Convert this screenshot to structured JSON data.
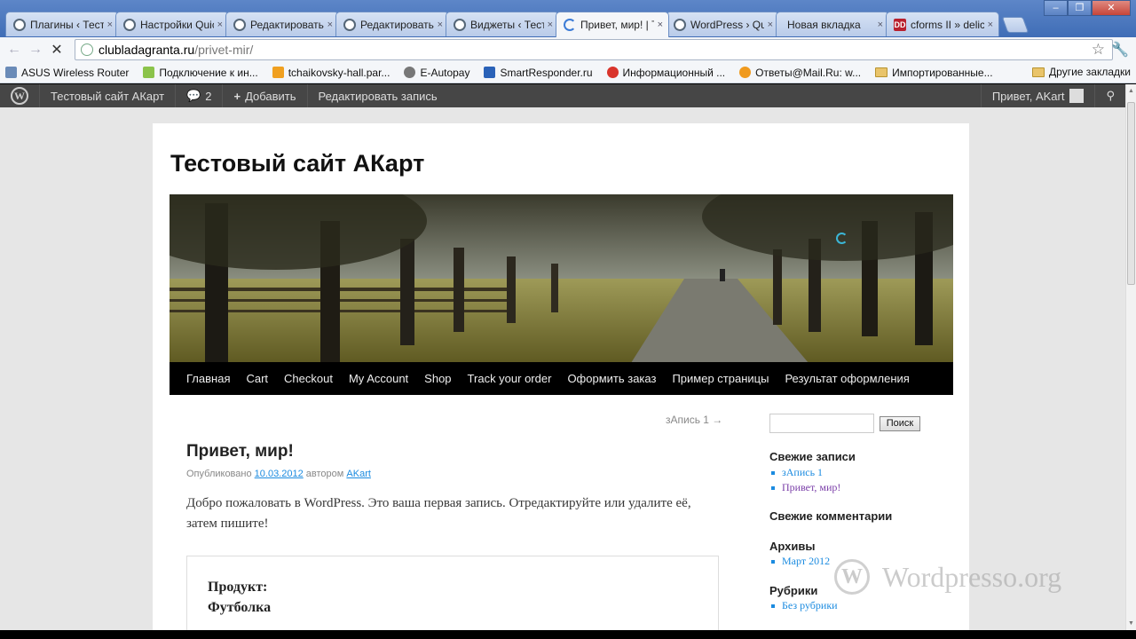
{
  "browser": {
    "tabs": [
      {
        "title": "Плагины ‹ Тест",
        "icon": "wordpress-icon"
      },
      {
        "title": "Настройки Quic",
        "icon": "wordpress-icon"
      },
      {
        "title": "Редактировать",
        "icon": "wordpress-icon"
      },
      {
        "title": "Редактировать",
        "icon": "wordpress-icon"
      },
      {
        "title": "Виджеты ‹ Тест",
        "icon": "wordpress-icon"
      },
      {
        "title": "Привет, мир! | Т",
        "icon": "loading-icon",
        "active": true
      },
      {
        "title": "WordPress › Qui",
        "icon": "wordpress-icon"
      },
      {
        "title": "Новая вкладка",
        "icon": "none"
      },
      {
        "title": "cforms II » delic",
        "icon": "dd-icon"
      }
    ],
    "close_glyph": "×",
    "omnibox": {
      "host": "clubladagranta.ru",
      "path": "/privet-mir/"
    },
    "bookmarks": [
      {
        "label": "ASUS Wireless Router",
        "icon": "bookmark-icon"
      },
      {
        "label": "Подключение к ин...",
        "icon": "bookmark-icon"
      },
      {
        "label": "tchaikovsky-hall.par...",
        "icon": "bookmark-icon"
      },
      {
        "label": "E-Autopay",
        "icon": "bookmark-icon"
      },
      {
        "label": "SmartResponder.ru",
        "icon": "bookmark-icon"
      },
      {
        "label": "Информационный ...",
        "icon": "bookmark-icon"
      },
      {
        "label": "Ответы@Mail.Ru: w...",
        "icon": "bookmark-icon"
      },
      {
        "label": "Импортированные...",
        "icon": "folder-icon"
      }
    ],
    "other_bookmarks": "Другие закладки"
  },
  "adminbar": {
    "site_name": "Тестовый сайт АКарт",
    "comments_count": "2",
    "add_label": "Добавить",
    "edit_label": "Редактировать запись",
    "greeting": "Привет, AKart"
  },
  "site": {
    "title": "Тестовый сайт АКарт",
    "menu": [
      "Главная",
      "Cart",
      "Checkout",
      "My Account",
      "Shop",
      "Track your order",
      "Оформить заказ",
      "Пример страницы",
      "Результат оформления"
    ]
  },
  "post": {
    "nav_next": "зАпись 1 →",
    "title": "Привет, мир!",
    "meta_prefix": "Опубликовано",
    "date": "10.03.2012",
    "meta_author_prefix": "автором",
    "author": "AKart",
    "body": "Добро пожаловать в WordPress. Это ваша первая запись. Отредактируйте или удалите её, затем пишите!",
    "product_label": "Продукт:",
    "product_name": "Футболка"
  },
  "sidebar": {
    "search_button": "Поиск",
    "recent_posts_title": "Свежие записи",
    "recent_posts": [
      "зАпись 1",
      "Привет, мир!"
    ],
    "recent_comments_title": "Свежие комментарии",
    "archives_title": "Архивы",
    "archives": [
      "Март 2012"
    ],
    "categories_title": "Рубрики",
    "categories": [
      "Без рубрики"
    ]
  },
  "watermark": {
    "text": "Wordpresso.org"
  }
}
